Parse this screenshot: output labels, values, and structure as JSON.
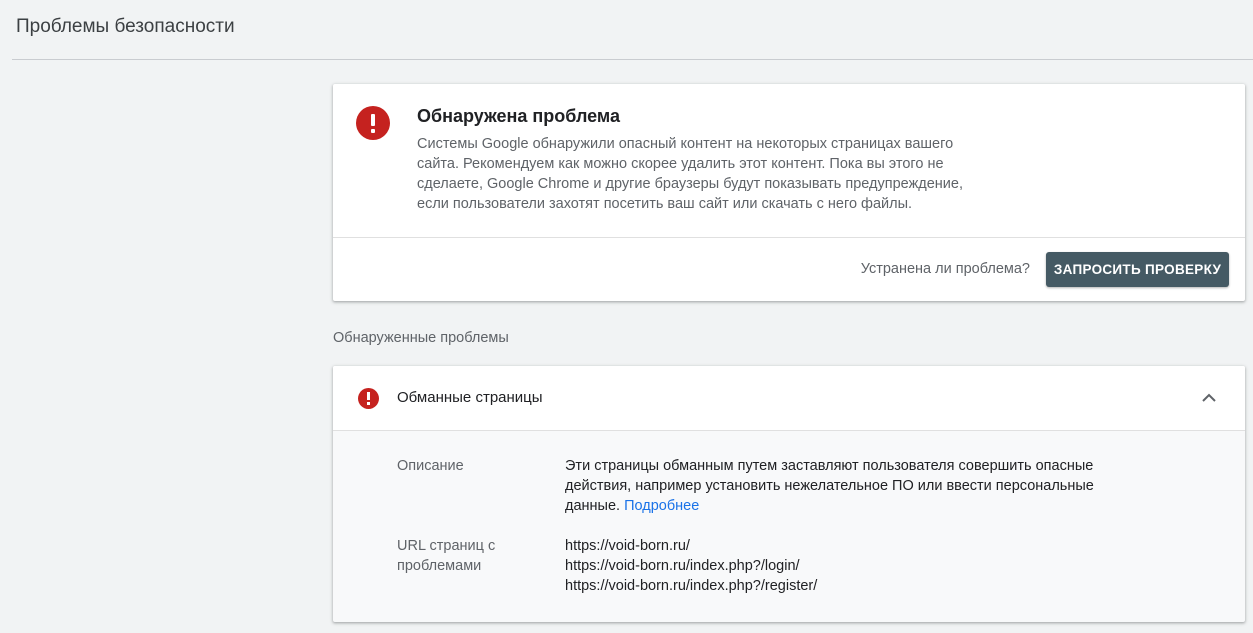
{
  "header": {
    "title": "Проблемы безопасности"
  },
  "alert": {
    "title": "Обнаружена проблема",
    "description": "Системы Google обнаружили опасный контент на некоторых страницах вашего сайта. Рекомендуем как можно скорее удалить этот контент. Пока вы этого не сделаете, Google Chrome и другие браузеры будут показывать предупреждение, если пользователи захотят посетить ваш сайт или скачать с него файлы.",
    "question": "Устранена ли проблема?",
    "request_button_label": "ЗАПРОСИТЬ ПРОВЕРКУ",
    "icon": "error-icon"
  },
  "issues_section": {
    "label": "Обнаруженные проблемы"
  },
  "issue": {
    "title": "Обманные страницы",
    "icon": "error-icon",
    "expand_icon": "chevron-up-icon",
    "description_label": "Описание",
    "description_text": "Эти страницы обманным путем заставляют пользователя совершить опасные действия, например установить нежелательное ПО или ввести персональные данные.",
    "learn_more_label": "Подробнее",
    "urls_label": "URL страниц с проблемами",
    "urls": [
      "https://void-born.ru/",
      "https://void-born.ru/index.php?/login/",
      "https://void-born.ru/index.php?/register/"
    ]
  },
  "colors": {
    "error": "#c5221f",
    "button": "#455a64",
    "link": "#1a73e8",
    "background": "#f1f3f4"
  }
}
